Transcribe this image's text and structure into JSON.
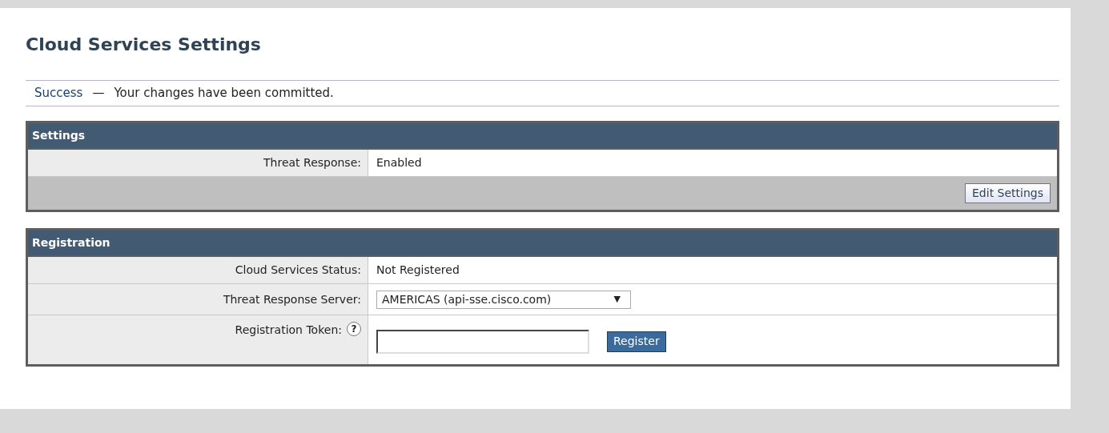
{
  "title": "Cloud Services Settings",
  "notice": {
    "status": "Success",
    "separator": "—",
    "message": "Your changes have been committed."
  },
  "sections": [
    {
      "title": "Settings",
      "rows": [
        {
          "kind": "text",
          "label": "Threat Response:",
          "value": "Enabled"
        }
      ],
      "footer_button": "Edit Settings"
    },
    {
      "title": "Registration",
      "rows": [
        {
          "kind": "text",
          "label": "Cloud Services Status:",
          "value": "Not Registered"
        },
        {
          "kind": "select",
          "label": "Threat Response Server:",
          "value": "AMERICAS (api-sse.cisco.com)",
          "arrow": "▼"
        },
        {
          "kind": "token",
          "label": "Registration Token:",
          "help": "?",
          "button": "Register"
        }
      ]
    }
  ]
}
